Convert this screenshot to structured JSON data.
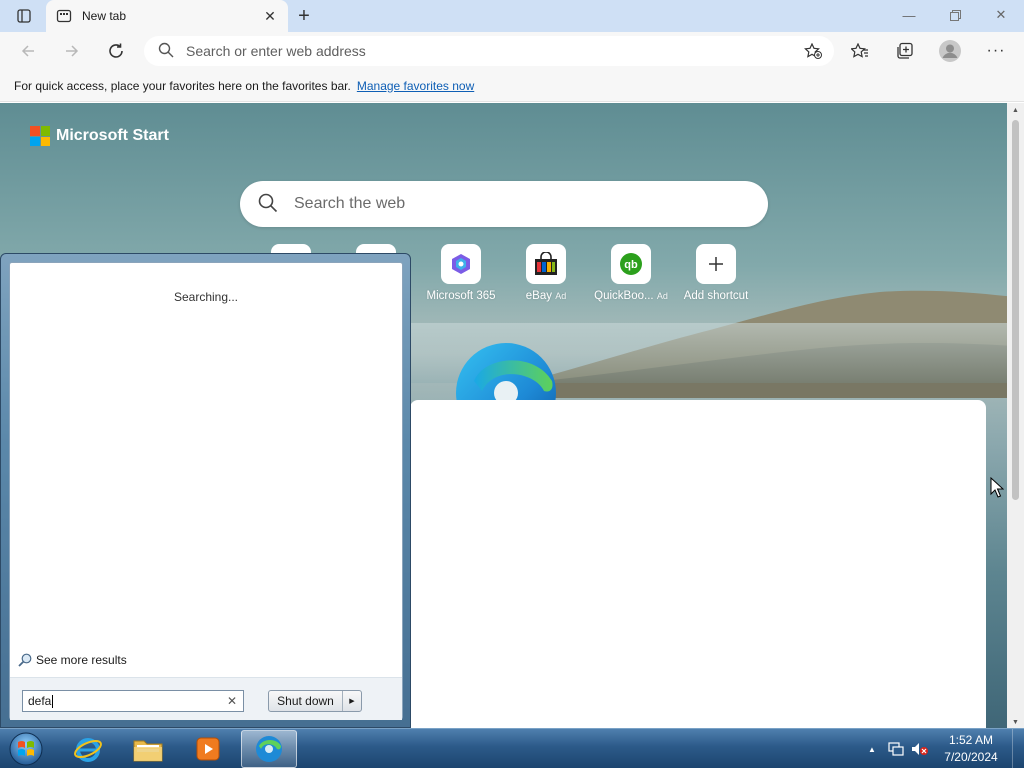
{
  "browser": {
    "tab_title": "New tab",
    "address_placeholder": "Search or enter web address",
    "favorites_bar_text": "For quick access, place your favorites here on the favorites bar.",
    "favorites_bar_link": "Manage favorites now"
  },
  "page": {
    "brand": "Microsoft Start",
    "search_placeholder": "Search the web",
    "shortcuts": [
      {
        "label": "Microsoft 365",
        "ad": ""
      },
      {
        "label": "eBay",
        "ad": "Ad"
      },
      {
        "label": "QuickBoo...",
        "ad": "Ad"
      },
      {
        "label": "Add shortcut",
        "ad": ""
      }
    ]
  },
  "start_menu": {
    "status": "Searching...",
    "see_more": "See more results",
    "search_value": "defa",
    "shutdown_label": "Shut down"
  },
  "taskbar": {
    "time": "1:52 AM",
    "date": "7/20/2024",
    "items": [
      "internet-explorer-icon",
      "file-explorer-icon",
      "media-player-icon",
      "edge-icon"
    ]
  },
  "colors": {
    "accent": "#0f5fb5",
    "taskbar": "#2c5a89"
  }
}
